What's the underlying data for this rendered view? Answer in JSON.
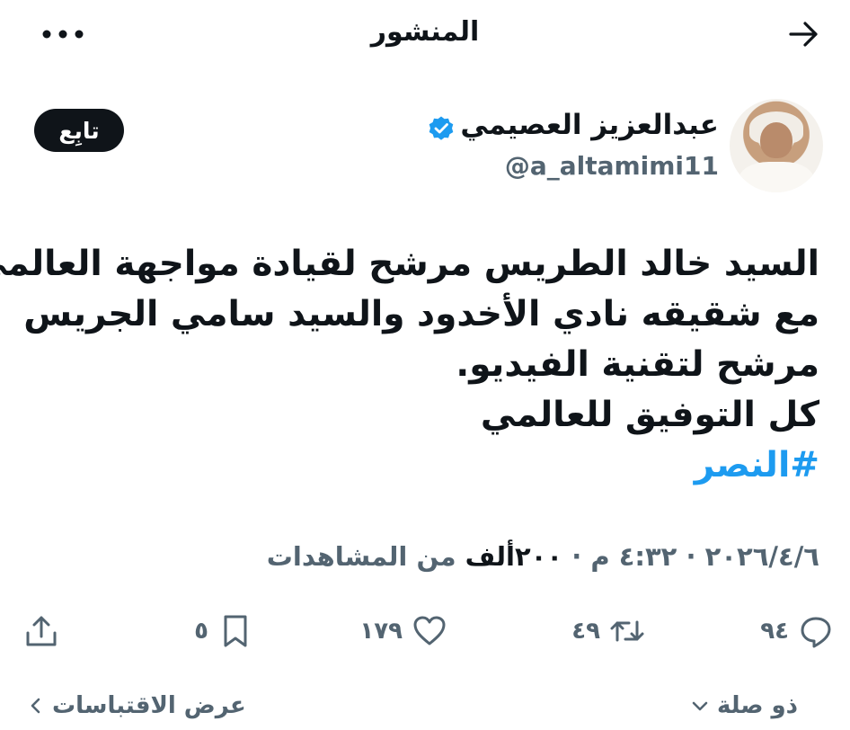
{
  "header": {
    "title": "المنشور"
  },
  "author": {
    "name": "عبدالعزيز العصيمي",
    "handle": "@a_altamimi11",
    "verified": true,
    "follow_label": "تابِع"
  },
  "post": {
    "lines": [
      "السيد خالد الطريس مرشح لقيادة مواجهة العالمي",
      "مع شقيقه نادي الأخدود والسيد سامي الجريس",
      "مرشح لتقنية الفيديو.",
      "كل التوفيق للعالمي"
    ],
    "hashtag": "#النصر"
  },
  "meta": {
    "date": "٢٠٢٦/٤/٦",
    "time": "٤:٣٢ م",
    "separator": " · ",
    "views": "٢٠٠ألف",
    "views_label": " من المشاهدات"
  },
  "actions": {
    "replies": "٩٤",
    "reposts": "٤٩",
    "likes": "١٧٩",
    "bookmarks": "٥"
  },
  "footer": {
    "relevance_label": "ذو صلة",
    "quotes_label": "عرض الاقتباسات"
  },
  "colors": {
    "text": "#0f1419",
    "secondary": "#536471",
    "accent": "#1d9bf0"
  }
}
